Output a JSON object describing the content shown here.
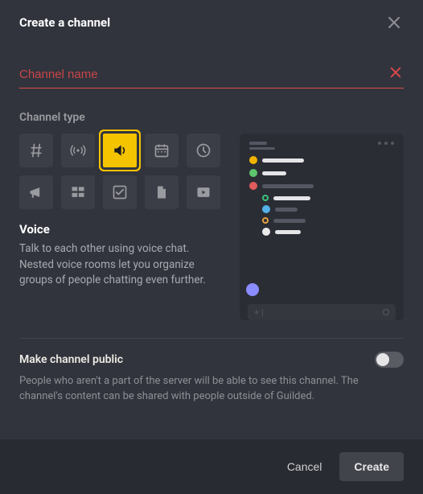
{
  "header": {
    "title": "Create a channel"
  },
  "name_input": {
    "placeholder": "Channel name",
    "value": ""
  },
  "section": {
    "type_label": "Channel type"
  },
  "types": {
    "selected_index": 2,
    "items": [
      {
        "name": "text",
        "icon": "hash"
      },
      {
        "name": "announcements",
        "icon": "broadcast"
      },
      {
        "name": "voice",
        "icon": "speaker"
      },
      {
        "name": "calendar",
        "icon": "calendar"
      },
      {
        "name": "scheduling",
        "icon": "clock"
      },
      {
        "name": "announce",
        "icon": "megaphone"
      },
      {
        "name": "list",
        "icon": "kanban"
      },
      {
        "name": "todo",
        "icon": "checkbox"
      },
      {
        "name": "docs",
        "icon": "document"
      },
      {
        "name": "media",
        "icon": "video"
      }
    ]
  },
  "type_info": {
    "title": "Voice",
    "description": "Talk to each other using voice chat. Nested voice rooms let you organize groups of people chatting even further."
  },
  "public": {
    "title": "Make channel public",
    "help": "People who aren't a part of the server will be able to see this channel. The channel's content can be shared with people outside of Guilded.",
    "enabled": false
  },
  "footer": {
    "cancel": "Cancel",
    "create": "Create"
  },
  "preview_colors": {
    "row1": "#f0b400",
    "row2": "#5cc76d",
    "row3": "#e05b5b",
    "ring1": "#3ac37a",
    "sub1": "#55b0e8",
    "ring2": "#e9a03c",
    "sub2": "#eaeaea",
    "float": "#8a8cff"
  }
}
